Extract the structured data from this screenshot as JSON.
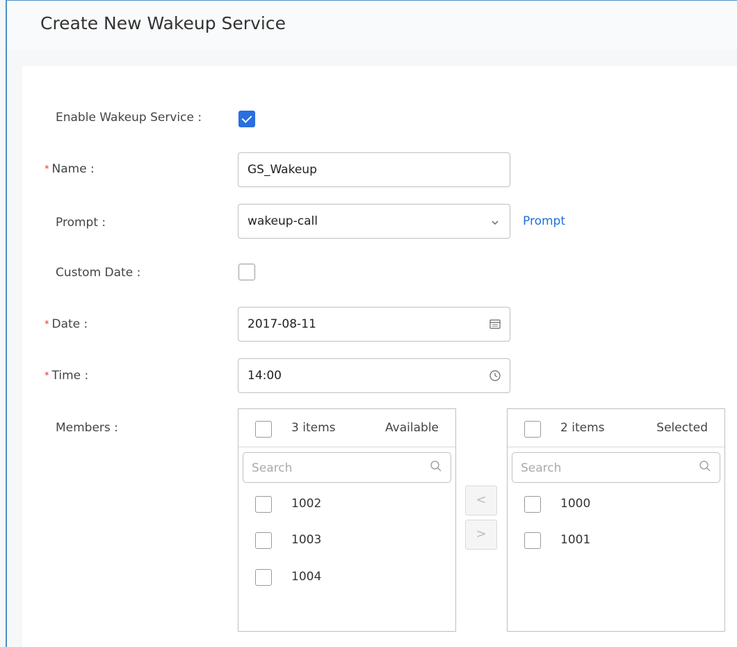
{
  "header": {
    "title": "Create New Wakeup Service"
  },
  "form": {
    "enable": {
      "label": "Enable Wakeup Service :",
      "checked": true
    },
    "name": {
      "label": "Name :",
      "required_mark": "*",
      "value": "GS_Wakeup"
    },
    "prompt": {
      "label": "Prompt :",
      "value": "wakeup-call",
      "link": "Prompt"
    },
    "custom_date": {
      "label": "Custom Date :",
      "checked": false
    },
    "date": {
      "label": "Date :",
      "required_mark": "*",
      "value": "2017-08-11"
    },
    "time": {
      "label": "Time :",
      "required_mark": "*",
      "value": "14:00"
    },
    "members": {
      "label": "Members :"
    }
  },
  "available": {
    "count": "3 items",
    "title": "Available",
    "search_placeholder": "Search",
    "items": [
      "1002",
      "1003",
      "1004"
    ]
  },
  "selected": {
    "count": "2 items",
    "title": "Selected",
    "search_placeholder": "Search",
    "items": [
      "1000",
      "1001"
    ]
  },
  "transfer": {
    "left": "<",
    "right": ">"
  },
  "colors": {
    "accent": "#2a6fe0",
    "link": "#1f6fd6",
    "required": "#e0342c",
    "frame": "#4a90c8"
  }
}
